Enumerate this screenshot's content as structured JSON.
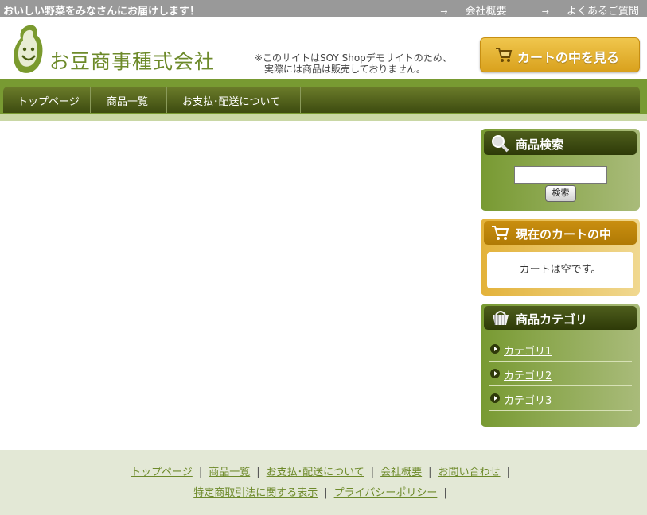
{
  "topbar": {
    "tagline": "おいしい野菜をみなさんにお届けします！",
    "links": [
      {
        "label": "会社概要",
        "icon": "arrow-right-icon"
      },
      {
        "label": "よくあるご質問",
        "icon": "arrow-right-icon"
      }
    ]
  },
  "header": {
    "logo_text": "お豆商事種式会社",
    "notice_line1": "※このサイトはSOY Shopデモサイトのため、",
    "notice_line2": "実際には商品は販売しておりません。",
    "cart_button": "カートの中を見る"
  },
  "nav": {
    "items": [
      "トップページ",
      "商品一覧",
      "お支払･配送について"
    ]
  },
  "sidebar": {
    "search": {
      "title": "商品検索",
      "input_value": "",
      "button": "検索"
    },
    "cart": {
      "title": "現在のカートの中",
      "status": "カートは空です。"
    },
    "categories": {
      "title": "商品カテゴリ",
      "items": [
        "カテゴリ1",
        "カテゴリ2",
        "カテゴリ3"
      ]
    }
  },
  "footer": {
    "row1": [
      "トップページ",
      "商品一覧",
      "お支払･配送について",
      "会社概要",
      "お問い合わせ"
    ],
    "row2": [
      "特定商取引法に関する表示",
      "プライバシーポリシー"
    ]
  },
  "colors": {
    "brand_green": "#6d8a2a",
    "nav_green": "#789a32",
    "cart_gold": "#e3b23a",
    "footer_bg": "#e3e8d6"
  }
}
